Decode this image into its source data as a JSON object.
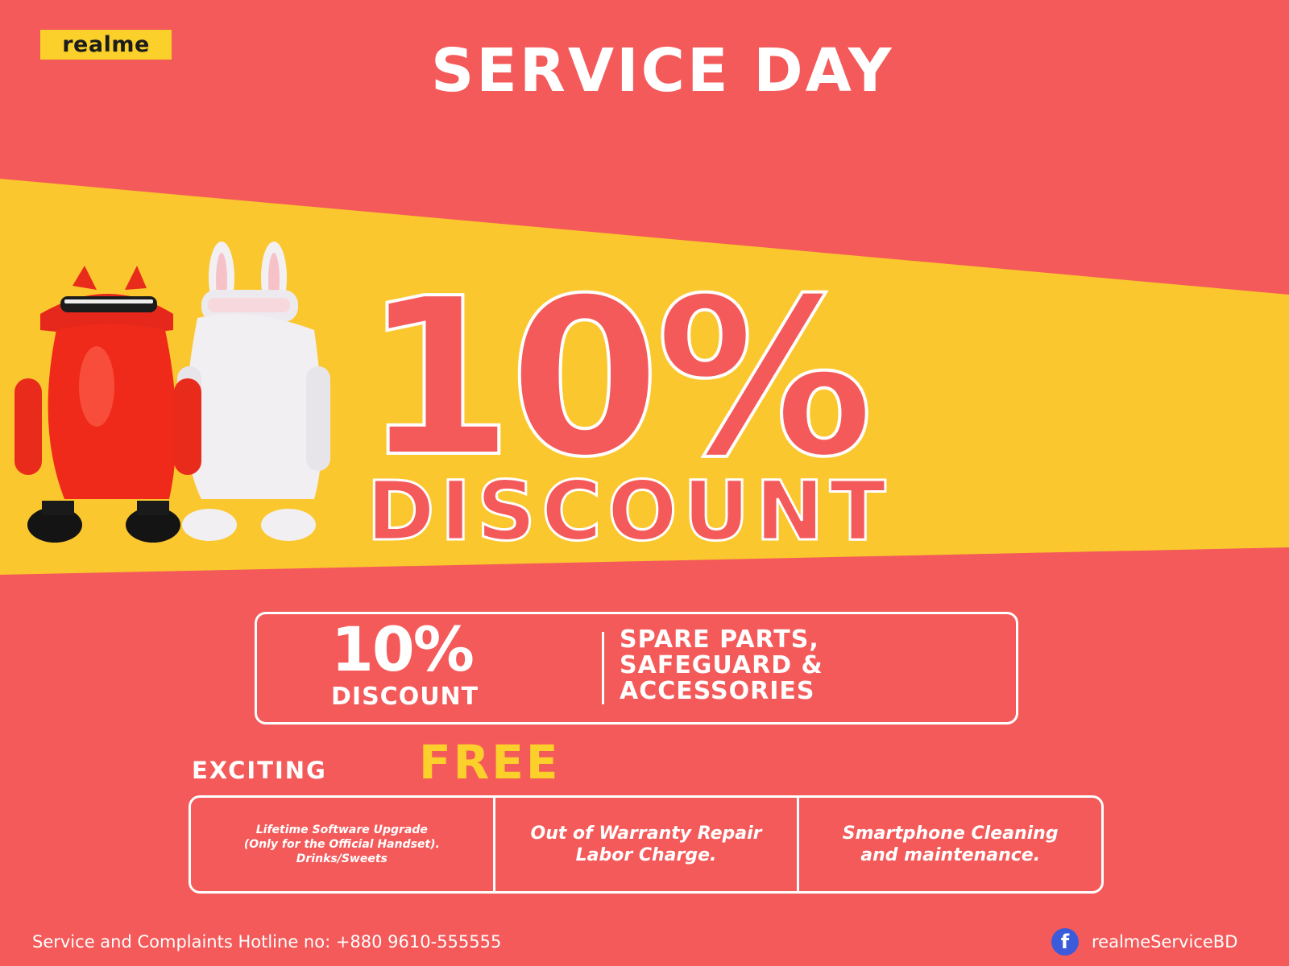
{
  "brand": {
    "logo_text": "realme"
  },
  "headline": "SERVICE DAY",
  "hero": {
    "percent": "10%",
    "label": "DISCOUNT"
  },
  "offer": {
    "percent": "10%",
    "label": "DISCOUNT",
    "items": [
      "SPARE PARTS,",
      "SAFEGUARD &",
      "ACCESSORIES"
    ]
  },
  "free_section": {
    "prefix": "EXCITING",
    "highlight": "FREE",
    "cells": [
      {
        "lines": [
          "Lifetime Software Upgrade",
          "(Only for the Official Handset).",
          "Drinks/Sweets"
        ]
      },
      {
        "lines": [
          "Out of Warranty Repair",
          "Labor Charge."
        ]
      },
      {
        "lines": [
          "Smartphone Cleaning",
          "and maintenance."
        ]
      }
    ]
  },
  "footer": {
    "hotline": "Service and Complaints Hotline no: +880 9610-555555",
    "social_handle": "realmeServiceBD",
    "social_icon": "facebook-icon"
  },
  "colors": {
    "background": "#f45a5a",
    "accent_yellow": "#fbd02b",
    "text": "#ffffff",
    "facebook_blue": "#3b5bdb"
  }
}
